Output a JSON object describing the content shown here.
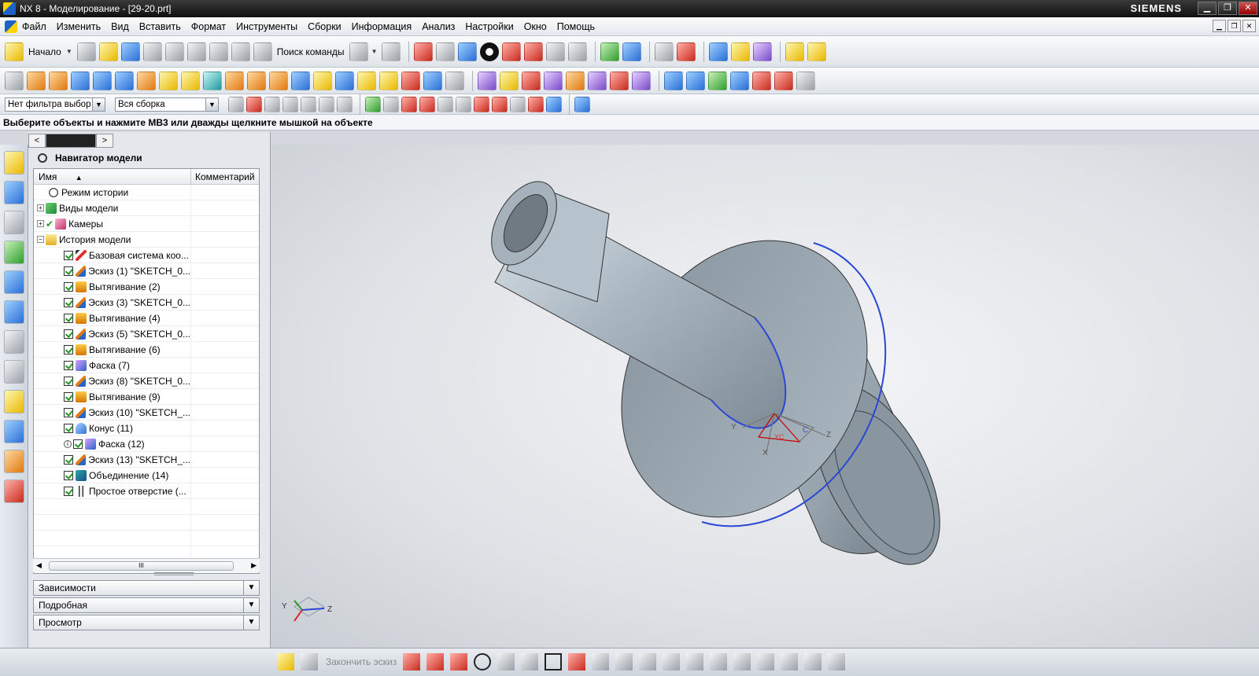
{
  "window": {
    "title": "NX 8 - Моделирование - [29-20.prt]",
    "brand": "SIEMENS",
    "controls": {
      "minimize": "▁",
      "restore": "❐",
      "close": "✕"
    }
  },
  "menu": {
    "items": [
      "Файл",
      "Изменить",
      "Вид",
      "Вставить",
      "Формат",
      "Инструменты",
      "Сборки",
      "Информация",
      "Анализ",
      "Настройки",
      "Окно",
      "Помощь"
    ]
  },
  "toolbar": {
    "start_label": "Начало",
    "command_search_label": "Поиск команды"
  },
  "selection_bar": {
    "type_filter": "Нет фильтра выбор",
    "scope_filter": "Вся сборка"
  },
  "cue_line": "Выберите объекты и нажмите MB3 или дважды щелкните мышкой на объекте",
  "navigator": {
    "title": "Навигатор модели",
    "col_name": "Имя",
    "col_comment": "Комментарий",
    "nodes": [
      {
        "label": "Режим истории",
        "icon": "clock-icon",
        "kind": "clock"
      },
      {
        "label": "Виды модели",
        "icon": "model-views-icon",
        "kind": "views"
      },
      {
        "label": "Камеры",
        "icon": "cameras-icon",
        "kind": "cam"
      },
      {
        "label": "История модели",
        "icon": "folder-icon",
        "kind": "folder"
      }
    ],
    "features": [
      {
        "label": "Базовая система коо...",
        "icon": "datum-csys-icon",
        "kind": "csys"
      },
      {
        "label": "Эскиз (1) \"SKETCH_0...",
        "icon": "sketch-icon",
        "kind": "sketch"
      },
      {
        "label": "Вытягивание (2)",
        "icon": "extrude-icon",
        "kind": "extrude"
      },
      {
        "label": "Эскиз (3) \"SKETCH_0...",
        "icon": "sketch-icon",
        "kind": "sketch"
      },
      {
        "label": "Вытягивание (4)",
        "icon": "extrude-icon",
        "kind": "extrude"
      },
      {
        "label": "Эскиз (5) \"SKETCH_0...",
        "icon": "sketch-icon",
        "kind": "sketch"
      },
      {
        "label": "Вытягивание (6)",
        "icon": "extrude-icon",
        "kind": "extrude"
      },
      {
        "label": "Фаска (7)",
        "icon": "chamfer-icon",
        "kind": "chamfer"
      },
      {
        "label": "Эскиз (8) \"SKETCH_0...",
        "icon": "sketch-icon",
        "kind": "sketch"
      },
      {
        "label": "Вытягивание (9)",
        "icon": "extrude-icon",
        "kind": "extrude"
      },
      {
        "label": "Эскиз (10) \"SKETCH_...",
        "icon": "sketch-icon",
        "kind": "sketch"
      },
      {
        "label": "Конус (11)",
        "icon": "cone-icon",
        "kind": "cone"
      },
      {
        "label": "Фаска (12)",
        "icon": "chamfer-icon",
        "kind": "chamfer"
      },
      {
        "label": "Эскиз (13) \"SKETCH_...",
        "icon": "sketch-icon",
        "kind": "sketch"
      },
      {
        "label": "Объединение (14)",
        "icon": "unite-icon",
        "kind": "unite"
      },
      {
        "label": "Простое отверстие (...",
        "icon": "hole-icon",
        "kind": "hole"
      }
    ],
    "scroll_grip": "III",
    "panels": [
      "Зависимости",
      "Подробная",
      "Просмотр"
    ]
  },
  "sketch_toolbar": {
    "finish_label": "Закончить эскиз"
  },
  "triad": {
    "x": "X",
    "y": "Y",
    "z": "Z",
    "c": "C",
    "xc": "XC"
  }
}
